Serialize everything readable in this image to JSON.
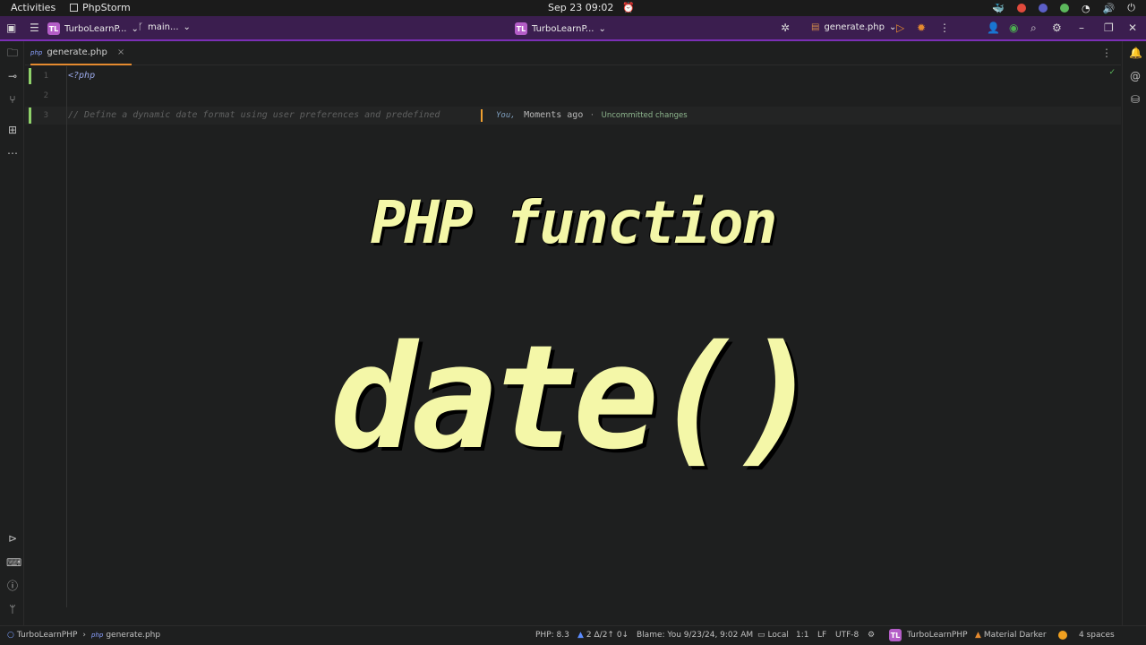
{
  "system_bar": {
    "activities": "Activities",
    "app_name": "PhpStorm",
    "clock": "Sep 23  09:02"
  },
  "titlebar": {
    "project_badge": "TL",
    "project_name": "TurboLearnP...",
    "branch": "main...",
    "center_badge": "TL",
    "center_project": "TurboLearnP...",
    "run_config": "generate.php"
  },
  "tabs": [
    {
      "label": "generate.php",
      "icon": "php-file-icon",
      "active": true
    }
  ],
  "editor": {
    "lines": [
      {
        "number": "1",
        "text": "<?php"
      },
      {
        "number": "2",
        "text": ""
      },
      {
        "number": "3",
        "text": "// Define a dynamic date format using user preferences and predefined"
      }
    ],
    "blame": {
      "author": "You,",
      "time": "Moments ago",
      "separator": "·",
      "status": "Uncommitted changes"
    }
  },
  "overlay": {
    "title": "PHP function",
    "function": "date()"
  },
  "statusbar": {
    "project": "TurboLearnPHP",
    "file": "generate.php",
    "php_version": "PHP: 8.3",
    "vcs": "2 Δ/2↑ 0↓",
    "blame": "Blame: You 9/23/24, 9:02 AM",
    "local": "Local",
    "position": "1:1",
    "line_sep": "LF",
    "encoding": "UTF-8",
    "badge": "TL",
    "project2": "TurboLearnPHP",
    "theme": "Material Darker",
    "indent": "4 spaces"
  },
  "colors": {
    "titlebar": "#3b1e4f",
    "accent": "#7b2fb5",
    "overlay_text": "#f4f7a8",
    "tab_underline": "#e58a2f",
    "change_marker": "#8fd16a"
  }
}
